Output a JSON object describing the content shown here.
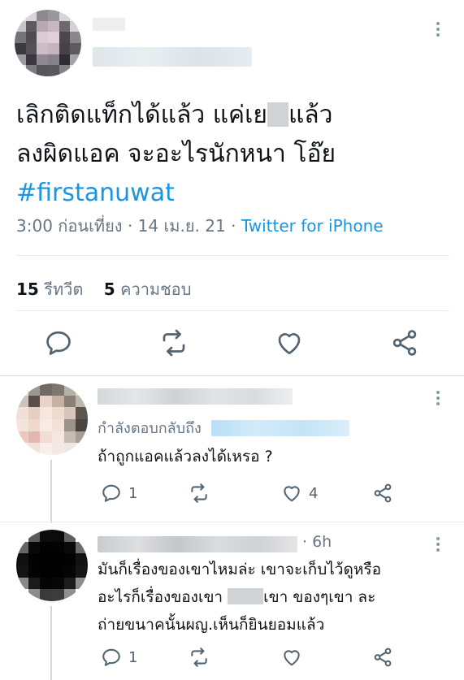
{
  "main_tweet": {
    "text_line1": "เลิกติดแท็กได้แล้ว แค่เย",
    "text_line1_end": "แล้ว",
    "text_line2": "ลงผิดแอค จะอะไรนักหนา โอ๊ย",
    "hashtag": "#firstanuwat",
    "time": "3:00 ก่อนเที่ยง",
    "separator": "·",
    "date": "14 เม.ย. 21",
    "source": "Twitter for iPhone",
    "retweet_count": "15",
    "retweet_label": "รีทวีต",
    "like_count": "5",
    "like_label": "ความชอบ"
  },
  "replies": [
    {
      "replying_to_label": "กำลังตอบกลับถึง",
      "text_lines": [
        "ถ้าถูกแอคแล้วลงได้เหรอ ?"
      ],
      "reply_count": "1",
      "retweet_count": "",
      "like_count": "4"
    },
    {
      "time": "· 6h",
      "text_lines": [
        "มันก็เรื่องของเขาไหมล่ะ เขาจะเก็บไว้ดูหรือ",
        "อะไรก็เรื่องของเขา",
        "เขา ของๆเขา ละ",
        "ถ่ายขนาคนั้นผญ.เห็นก็ยินยอมแล้ว"
      ],
      "reply_count": "1",
      "retweet_count": "",
      "like_count": ""
    }
  ],
  "icons": {
    "reply": "reply-icon",
    "retweet": "retweet-icon",
    "like": "heart-icon",
    "share": "share-icon",
    "more": "more-vertical-icon"
  },
  "colors": {
    "link": "#1b95e0",
    "secondary_text": "#687684",
    "divider": "#e6ecf0",
    "icon": "#536471"
  }
}
